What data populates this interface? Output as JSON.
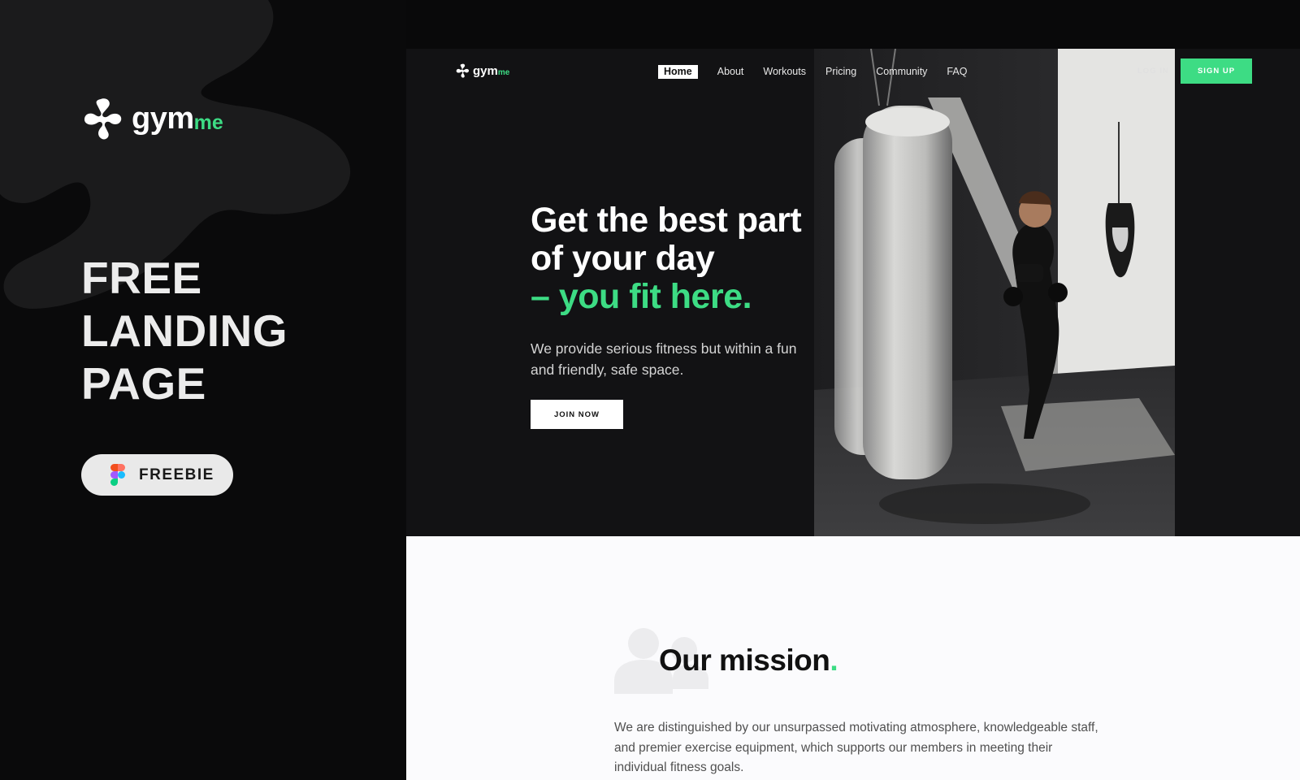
{
  "promo": {
    "logo_word": "gym",
    "logo_accent": "me",
    "title_lines": [
      "FREE",
      "LANDING",
      "PAGE"
    ],
    "freebie_label": "FREEBIE",
    "freebie_icon": "figma-icon"
  },
  "site": {
    "logo_word": "gym",
    "logo_accent": "me",
    "nav": {
      "items": [
        {
          "label": "Home",
          "active": true
        },
        {
          "label": "About"
        },
        {
          "label": "Workouts"
        },
        {
          "label": "Pricing"
        },
        {
          "label": "Community"
        },
        {
          "label": "FAQ"
        }
      ],
      "login_label": "LOG IN",
      "signup_label": "SIGN UP"
    },
    "hero": {
      "headline_line1": "Get the best part",
      "headline_line2": "of your day",
      "headline_line3": "– you fit here.",
      "subtext": "We provide serious fitness but within a fun and friendly, safe space.",
      "cta_label": "JOIN NOW"
    },
    "mission": {
      "title": "Our mission",
      "title_dot": ".",
      "text": "We are distinguished by our unsurpassed motivating atmosphere, knowledgeable staff, and premier exercise equipment, which supports our members in meeting their individual fitness goals."
    }
  },
  "colors": {
    "accent": "#3ddc84",
    "background": "#0a0a0b",
    "hero_bg": "#121214",
    "mission_bg": "#fbfbfd",
    "freebie_bg": "#e9e9e9"
  }
}
